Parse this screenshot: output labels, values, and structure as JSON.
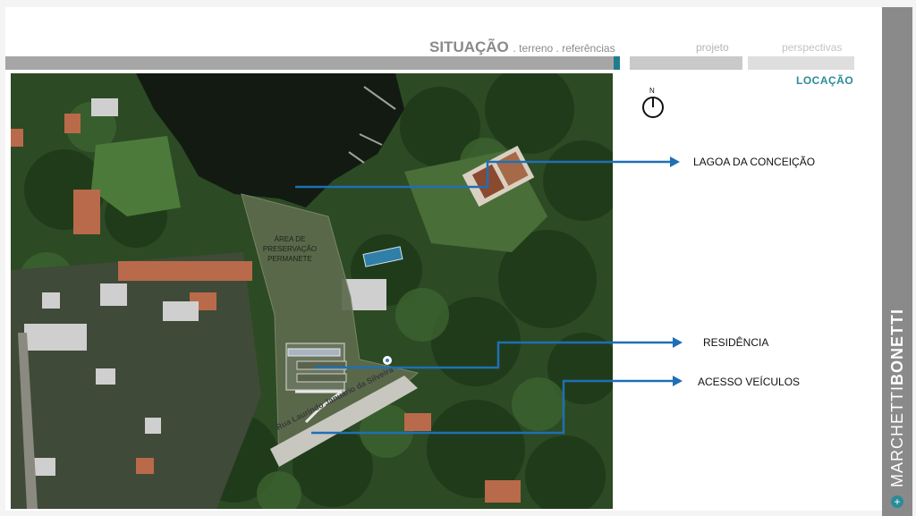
{
  "header": {
    "title": "SITUAÇÃO",
    "subtitle": ". terreno . referências",
    "nav_projeto": "projeto",
    "nav_perspectivas": "perspectivas",
    "active_sub": "LOCAÇÃO"
  },
  "compass": {
    "letter": "N"
  },
  "map": {
    "area_label": "ÁREA DE PRESERVAÇÃO PERMANETE",
    "street_label": "Rua Laurindo Januário da Silveira"
  },
  "callouts": [
    {
      "label": "LAGOA DA CONCEIÇÃO"
    },
    {
      "label": "RESIDÊNCIA"
    },
    {
      "label": "ACESSO VEÍCULOS"
    }
  ],
  "brand": {
    "part1": "MARCHETTI",
    "part2": "BONETTI"
  },
  "colors": {
    "accent": "#2a8c98",
    "arrow": "#1f6fb5",
    "nav_bar": "#a6a6a6"
  }
}
